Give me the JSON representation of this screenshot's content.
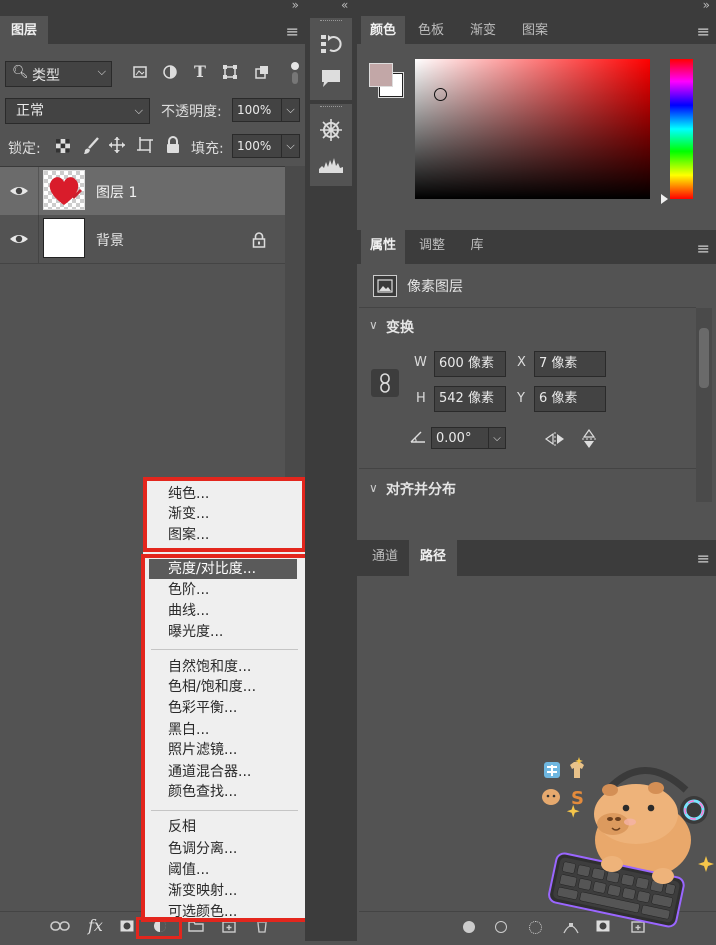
{
  "layers_panel": {
    "tab": "图层",
    "filter_type": "类型",
    "blend_mode": "正常",
    "opacity_label": "不透明度:",
    "opacity_value": "100%",
    "lock_label": "锁定:",
    "fill_label": "填充:",
    "fill_value": "100%",
    "layers": [
      {
        "name": "图层 1",
        "visible": true,
        "selected": true
      },
      {
        "name": "背景",
        "visible": true,
        "locked": true
      }
    ],
    "footer_fx": "fx"
  },
  "adjustment_menu": {
    "fill_items": [
      "纯色...",
      "渐变...",
      "图案..."
    ],
    "group1": [
      "亮度/对比度...",
      "色阶...",
      "曲线...",
      "曝光度..."
    ],
    "group2": [
      "自然饱和度...",
      "色相/饱和度...",
      "色彩平衡...",
      "黑白...",
      "照片滤镜...",
      "通道混合器...",
      "颜色查找..."
    ],
    "group3": [
      "反相",
      "色调分离...",
      "阈值...",
      "渐变映射...",
      "可选颜色..."
    ],
    "highlighted": "亮度/对比度..."
  },
  "color_panel": {
    "tabs": [
      "颜色",
      "色板",
      "渐变",
      "图案"
    ],
    "active_tab": "颜色",
    "foreground_color": "#c2a7a7",
    "background_color": "#ffffff",
    "hue_color": "#ff0000"
  },
  "properties_panel": {
    "tabs": [
      "属性",
      "调整",
      "库"
    ],
    "active_tab": "属性",
    "layer_kind": "像素图层",
    "transform_section": "变换",
    "w_label": "W",
    "w_value": "600 像素",
    "h_label": "H",
    "h_value": "542 像素",
    "x_label": "X",
    "x_value": "7 像素",
    "y_label": "Y",
    "y_value": "6 像素",
    "angle_value": "0.00°",
    "align_section": "对齐并分布"
  },
  "paths_panel": {
    "tabs": [
      "通道",
      "路径"
    ],
    "active_tab": "路径"
  },
  "icons": {
    "collapse_left": "«",
    "collapse_right": "»",
    "panel_menu": "≡"
  },
  "sticker": {
    "text_s": "S"
  }
}
